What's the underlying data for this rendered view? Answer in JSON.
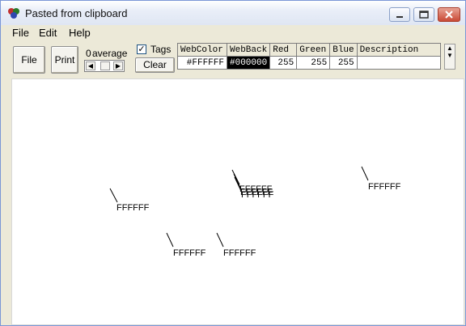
{
  "window": {
    "title": "Pasted from clipboard"
  },
  "menu": [
    "File",
    "Edit",
    "Help"
  ],
  "toolbar": {
    "file_label": "File",
    "print_label": "Print",
    "average_value": "0",
    "average_label": "average",
    "tags_label": "Tags",
    "tags_checked": true,
    "clear_label": "Clear"
  },
  "grid": {
    "headers": [
      "WebColor",
      "WebBack",
      "Red",
      "Green",
      "Blue",
      "Description"
    ],
    "row": [
      "#FFFFFF",
      "#000000",
      "255",
      "255",
      "255",
      ""
    ]
  },
  "tags": [
    "FFFFFF",
    "FFFFFF",
    "FFFFFF",
    "FFFFFF",
    "FFFFFF",
    "FFFFFF",
    "FFFFFF"
  ],
  "colors": {
    "title_bg": "#e9eef8",
    "canvas_bg": "#ffffff",
    "selected_cell_bg": "#000000"
  }
}
